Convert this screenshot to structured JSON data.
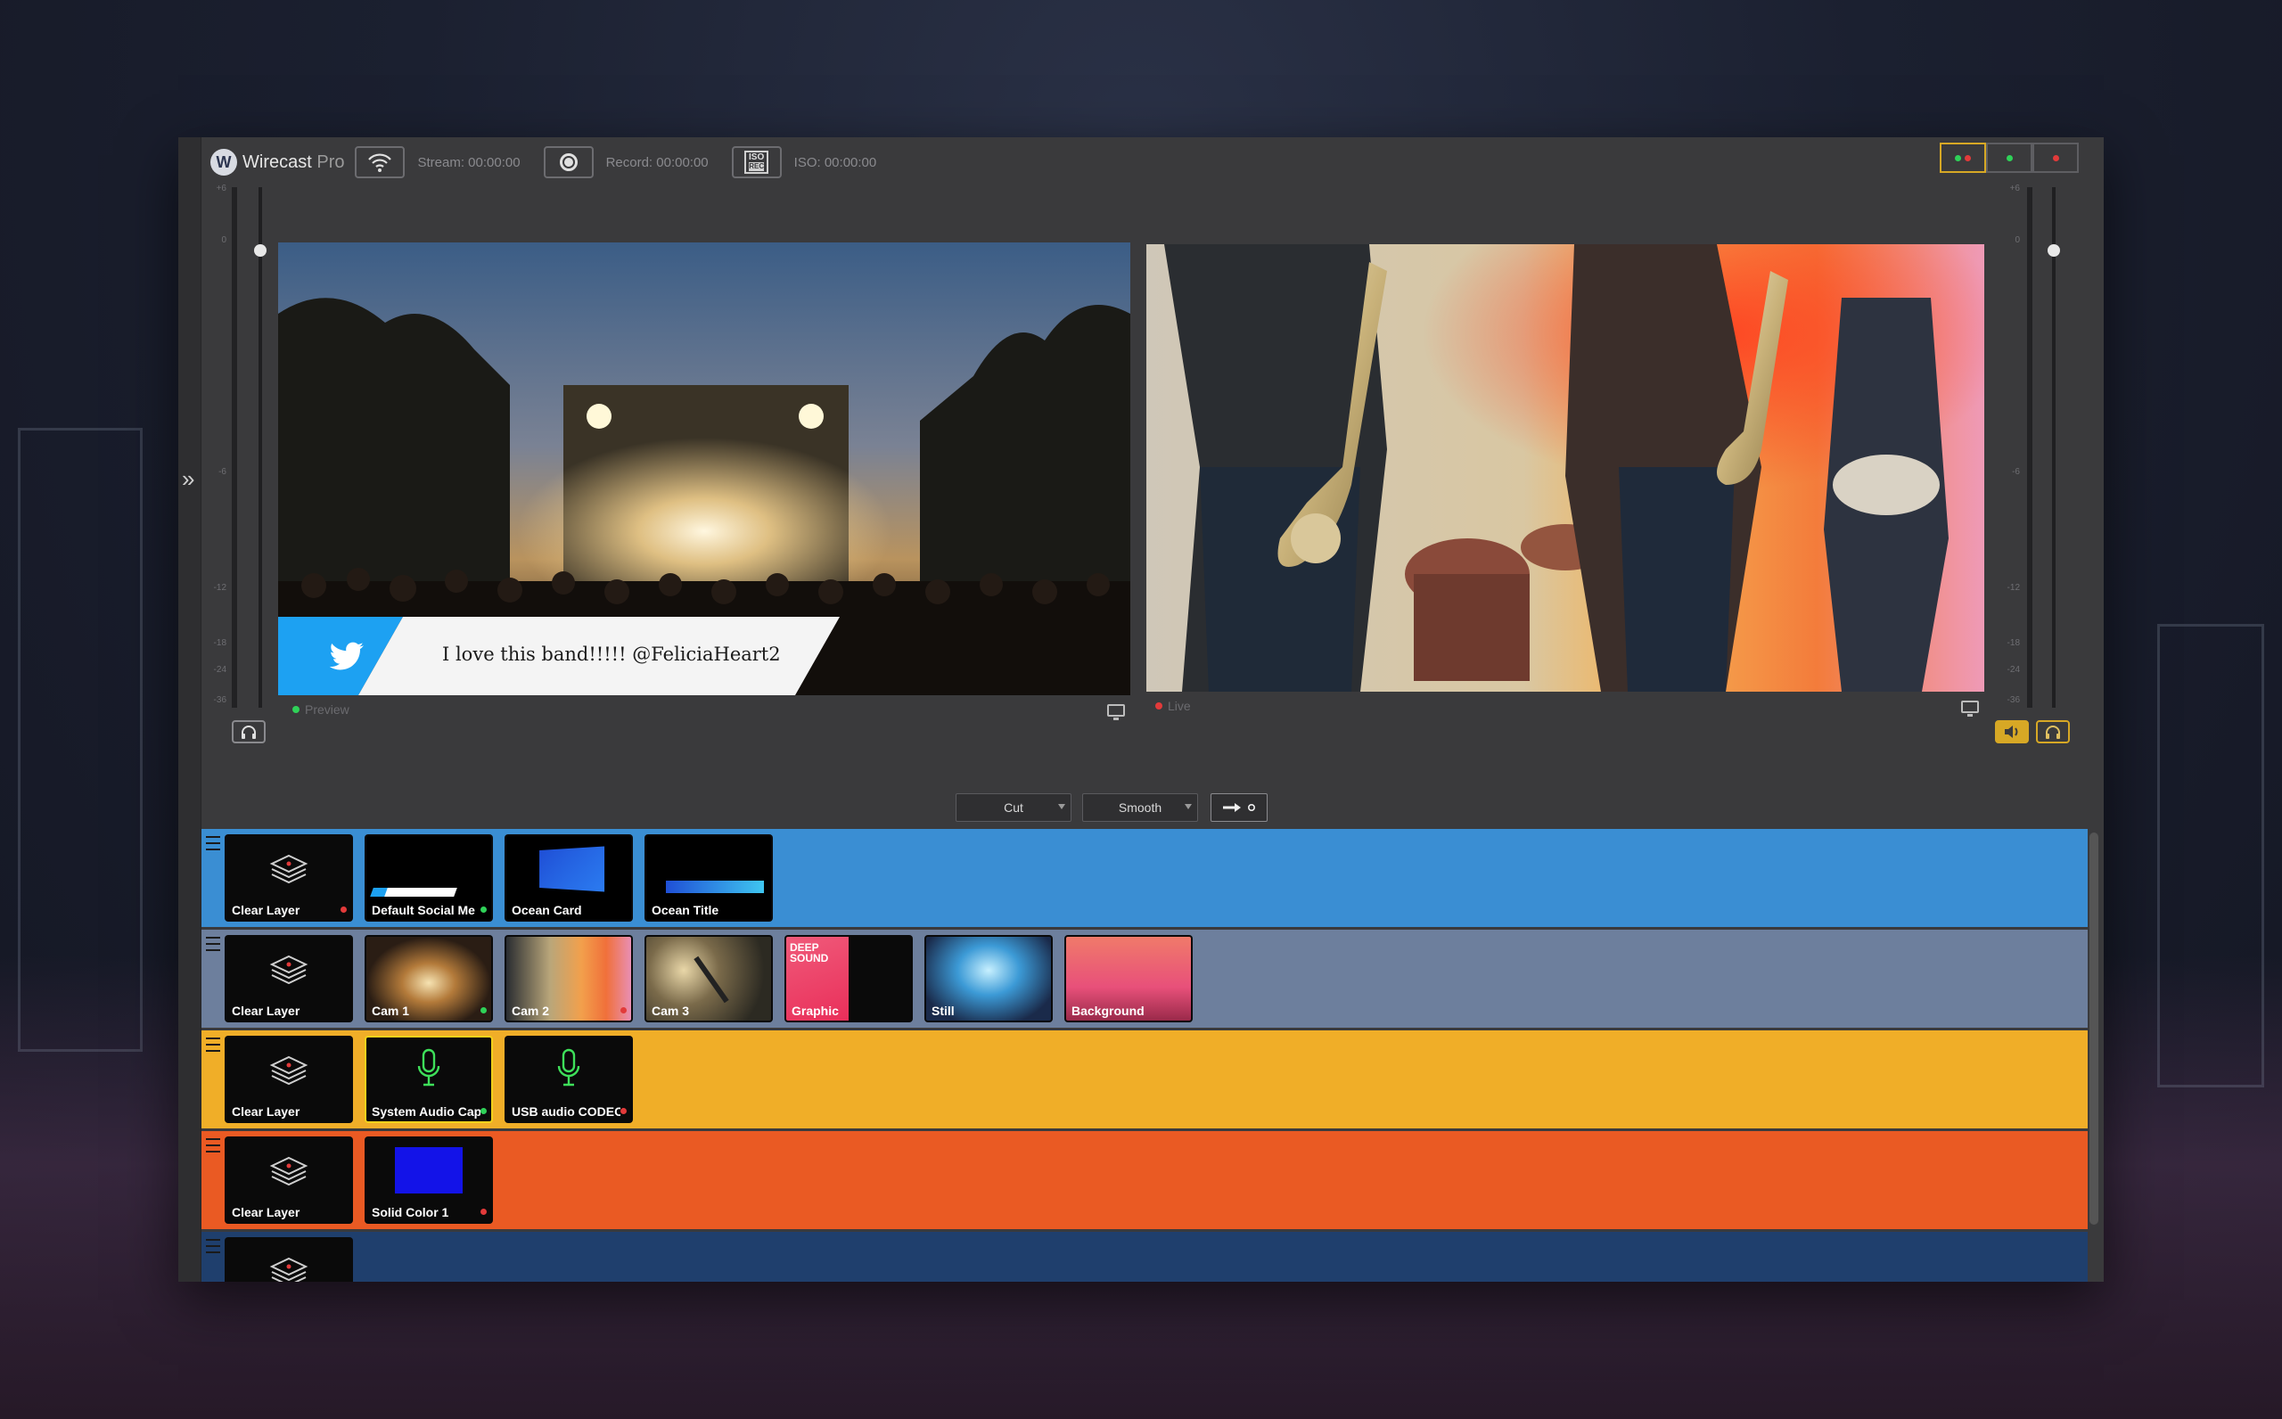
{
  "app": {
    "name": "Wirecast",
    "edition": "Pro",
    "logo_letter": "W"
  },
  "toolbar": {
    "stream_label": "Stream:",
    "stream_time": "00:00:00",
    "record_label": "Record:",
    "record_time": "00:00:00",
    "iso_icon_top": "ISO",
    "iso_icon_bottom": "REC",
    "iso_label": "ISO:",
    "iso_time": "00:00:00"
  },
  "meters": {
    "scale": [
      "+6",
      "0",
      "-6",
      "-12",
      "-18",
      "-24",
      "-36"
    ]
  },
  "preview": {
    "label": "Preview",
    "status_color": "#2fd158",
    "lower_third_text": "I love this band!!!!! @FeliciaHeart2",
    "lower_third_icon": "twitter-bird-icon"
  },
  "live": {
    "label": "Live",
    "status_color": "#e23a3a"
  },
  "transition": {
    "cut_label": "Cut",
    "smooth_label": "Smooth",
    "go_icon": "arrow-right-icon"
  },
  "colors": {
    "layer1": "#3a8ed3",
    "layer2": "#6d7f9d",
    "layer3": "#f0ae28",
    "layer4": "#ea5a23",
    "layer5": "#1f3f6d",
    "accent": "#d7a825"
  },
  "layers": [
    {
      "shots": [
        {
          "label": "Clear Layer",
          "status": "red",
          "thumb": "clear"
        },
        {
          "label": "Default Social Me",
          "status": "green",
          "thumb": "social"
        },
        {
          "label": "Ocean Card",
          "status": "",
          "thumb": "ocean-card"
        },
        {
          "label": "Ocean Title",
          "status": "",
          "thumb": "ocean-title"
        }
      ]
    },
    {
      "shots": [
        {
          "label": "Clear Layer",
          "status": "",
          "thumb": "clear"
        },
        {
          "label": "Cam 1",
          "status": "green",
          "thumb": "cam1"
        },
        {
          "label": "Cam 2",
          "status": "red",
          "thumb": "cam2"
        },
        {
          "label": "Cam 3",
          "status": "",
          "thumb": "cam3"
        },
        {
          "label": "Graphic",
          "status": "",
          "thumb": "graphic",
          "graphic_text": "DEEP SOUND"
        },
        {
          "label": "Still",
          "status": "",
          "thumb": "still"
        },
        {
          "label": "Background",
          "status": "",
          "thumb": "background"
        }
      ]
    },
    {
      "shots": [
        {
          "label": "Clear Layer",
          "status": "",
          "thumb": "clear"
        },
        {
          "label": "System Audio Cap",
          "status": "green",
          "thumb": "mic",
          "selected": true
        },
        {
          "label": "USB audio CODEC",
          "status": "red",
          "thumb": "mic"
        }
      ]
    },
    {
      "shots": [
        {
          "label": "Clear Layer",
          "status": "",
          "thumb": "clear"
        },
        {
          "label": "Solid Color 1",
          "status": "red",
          "thumb": "solid"
        }
      ]
    },
    {
      "shots": [
        {
          "label": "",
          "status": "",
          "thumb": "clear"
        }
      ]
    }
  ]
}
